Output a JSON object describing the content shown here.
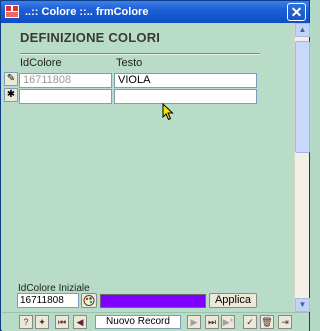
{
  "window": {
    "title": "..:: Colore ::..  frmColore",
    "close_glyph": "✕"
  },
  "form": {
    "heading": "DEFINIZIONE COLORI",
    "columns": {
      "id": "IdColore",
      "testo": "Testo"
    },
    "rows": [
      {
        "selector": "✎",
        "id": "16711808",
        "testo": "VIOLA"
      },
      {
        "selector": "✱",
        "id": "",
        "testo": ""
      }
    ]
  },
  "footer": {
    "label": "IdColore Iniziale",
    "value": "16711808",
    "swatch_color": "#8000ff",
    "apply_label": "Applica"
  },
  "navbar": {
    "record_label": "Nuovo Record"
  },
  "scrollbar": {
    "up": "▲",
    "down": "▼"
  }
}
